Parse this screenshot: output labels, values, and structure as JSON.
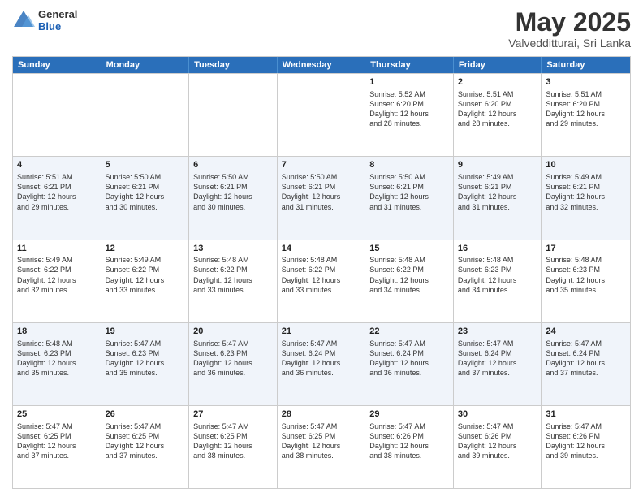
{
  "header": {
    "logo_general": "General",
    "logo_blue": "Blue",
    "month": "May 2025",
    "location": "Valvedditturai, Sri Lanka"
  },
  "days": [
    "Sunday",
    "Monday",
    "Tuesday",
    "Wednesday",
    "Thursday",
    "Friday",
    "Saturday"
  ],
  "rows": [
    [
      {
        "day": "",
        "text": ""
      },
      {
        "day": "",
        "text": ""
      },
      {
        "day": "",
        "text": ""
      },
      {
        "day": "",
        "text": ""
      },
      {
        "day": "1",
        "text": "Sunrise: 5:52 AM\nSunset: 6:20 PM\nDaylight: 12 hours\nand 28 minutes."
      },
      {
        "day": "2",
        "text": "Sunrise: 5:51 AM\nSunset: 6:20 PM\nDaylight: 12 hours\nand 28 minutes."
      },
      {
        "day": "3",
        "text": "Sunrise: 5:51 AM\nSunset: 6:20 PM\nDaylight: 12 hours\nand 29 minutes."
      }
    ],
    [
      {
        "day": "4",
        "text": "Sunrise: 5:51 AM\nSunset: 6:21 PM\nDaylight: 12 hours\nand 29 minutes."
      },
      {
        "day": "5",
        "text": "Sunrise: 5:50 AM\nSunset: 6:21 PM\nDaylight: 12 hours\nand 30 minutes."
      },
      {
        "day": "6",
        "text": "Sunrise: 5:50 AM\nSunset: 6:21 PM\nDaylight: 12 hours\nand 30 minutes."
      },
      {
        "day": "7",
        "text": "Sunrise: 5:50 AM\nSunset: 6:21 PM\nDaylight: 12 hours\nand 31 minutes."
      },
      {
        "day": "8",
        "text": "Sunrise: 5:50 AM\nSunset: 6:21 PM\nDaylight: 12 hours\nand 31 minutes."
      },
      {
        "day": "9",
        "text": "Sunrise: 5:49 AM\nSunset: 6:21 PM\nDaylight: 12 hours\nand 31 minutes."
      },
      {
        "day": "10",
        "text": "Sunrise: 5:49 AM\nSunset: 6:21 PM\nDaylight: 12 hours\nand 32 minutes."
      }
    ],
    [
      {
        "day": "11",
        "text": "Sunrise: 5:49 AM\nSunset: 6:22 PM\nDaylight: 12 hours\nand 32 minutes."
      },
      {
        "day": "12",
        "text": "Sunrise: 5:49 AM\nSunset: 6:22 PM\nDaylight: 12 hours\nand 33 minutes."
      },
      {
        "day": "13",
        "text": "Sunrise: 5:48 AM\nSunset: 6:22 PM\nDaylight: 12 hours\nand 33 minutes."
      },
      {
        "day": "14",
        "text": "Sunrise: 5:48 AM\nSunset: 6:22 PM\nDaylight: 12 hours\nand 33 minutes."
      },
      {
        "day": "15",
        "text": "Sunrise: 5:48 AM\nSunset: 6:22 PM\nDaylight: 12 hours\nand 34 minutes."
      },
      {
        "day": "16",
        "text": "Sunrise: 5:48 AM\nSunset: 6:23 PM\nDaylight: 12 hours\nand 34 minutes."
      },
      {
        "day": "17",
        "text": "Sunrise: 5:48 AM\nSunset: 6:23 PM\nDaylight: 12 hours\nand 35 minutes."
      }
    ],
    [
      {
        "day": "18",
        "text": "Sunrise: 5:48 AM\nSunset: 6:23 PM\nDaylight: 12 hours\nand 35 minutes."
      },
      {
        "day": "19",
        "text": "Sunrise: 5:47 AM\nSunset: 6:23 PM\nDaylight: 12 hours\nand 35 minutes."
      },
      {
        "day": "20",
        "text": "Sunrise: 5:47 AM\nSunset: 6:23 PM\nDaylight: 12 hours\nand 36 minutes."
      },
      {
        "day": "21",
        "text": "Sunrise: 5:47 AM\nSunset: 6:24 PM\nDaylight: 12 hours\nand 36 minutes."
      },
      {
        "day": "22",
        "text": "Sunrise: 5:47 AM\nSunset: 6:24 PM\nDaylight: 12 hours\nand 36 minutes."
      },
      {
        "day": "23",
        "text": "Sunrise: 5:47 AM\nSunset: 6:24 PM\nDaylight: 12 hours\nand 37 minutes."
      },
      {
        "day": "24",
        "text": "Sunrise: 5:47 AM\nSunset: 6:24 PM\nDaylight: 12 hours\nand 37 minutes."
      }
    ],
    [
      {
        "day": "25",
        "text": "Sunrise: 5:47 AM\nSunset: 6:25 PM\nDaylight: 12 hours\nand 37 minutes."
      },
      {
        "day": "26",
        "text": "Sunrise: 5:47 AM\nSunset: 6:25 PM\nDaylight: 12 hours\nand 37 minutes."
      },
      {
        "day": "27",
        "text": "Sunrise: 5:47 AM\nSunset: 6:25 PM\nDaylight: 12 hours\nand 38 minutes."
      },
      {
        "day": "28",
        "text": "Sunrise: 5:47 AM\nSunset: 6:25 PM\nDaylight: 12 hours\nand 38 minutes."
      },
      {
        "day": "29",
        "text": "Sunrise: 5:47 AM\nSunset: 6:26 PM\nDaylight: 12 hours\nand 38 minutes."
      },
      {
        "day": "30",
        "text": "Sunrise: 5:47 AM\nSunset: 6:26 PM\nDaylight: 12 hours\nand 39 minutes."
      },
      {
        "day": "31",
        "text": "Sunrise: 5:47 AM\nSunset: 6:26 PM\nDaylight: 12 hours\nand 39 minutes."
      }
    ]
  ]
}
